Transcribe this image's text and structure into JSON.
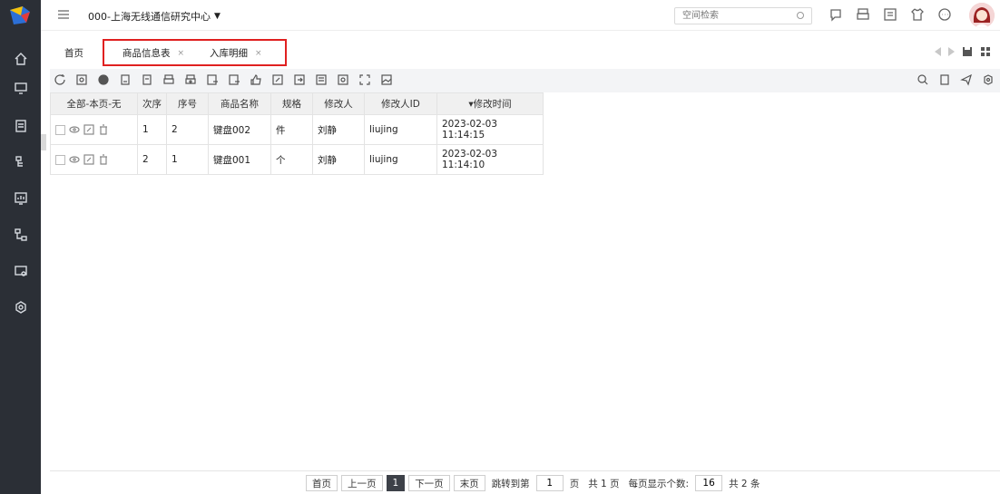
{
  "header": {
    "org_name": "000-上海无线通信研究中心",
    "search_placeholder": "空间检索"
  },
  "tabs": [
    {
      "label": "首页"
    },
    {
      "label": "商品信息表",
      "close": "×"
    },
    {
      "label": "入库明细",
      "close": "×"
    }
  ],
  "grid": {
    "columns": [
      "全部-本页-无",
      "次序",
      "序号",
      "商品名称",
      "规格",
      "修改人",
      "修改人ID",
      "▾修改时间"
    ],
    "rows": [
      {
        "order": "1",
        "seq": "2",
        "name": "键盘002",
        "spec": "件",
        "modifier": "刘静",
        "modifier_id": "liujing",
        "time": "2023-02-03 11:14:15"
      },
      {
        "order": "2",
        "seq": "1",
        "name": "键盘001",
        "spec": "个",
        "modifier": "刘静",
        "modifier_id": "liujing",
        "time": "2023-02-03 11:14:10"
      }
    ]
  },
  "pager": {
    "first": "首页",
    "prev": "上一页",
    "current": "1",
    "next": "下一页",
    "last": "末页",
    "jump_label": "跳转到第",
    "jump_value": "1",
    "page_unit": "页",
    "total_pages": "共 1 页",
    "page_size_label": "每页显示个数:",
    "page_size": "16",
    "total_items": "共 2 条"
  },
  "colors": {
    "sidebar": "#2b2f36",
    "accent_dark": "#3d4148",
    "highlight_red": "#e02020"
  }
}
